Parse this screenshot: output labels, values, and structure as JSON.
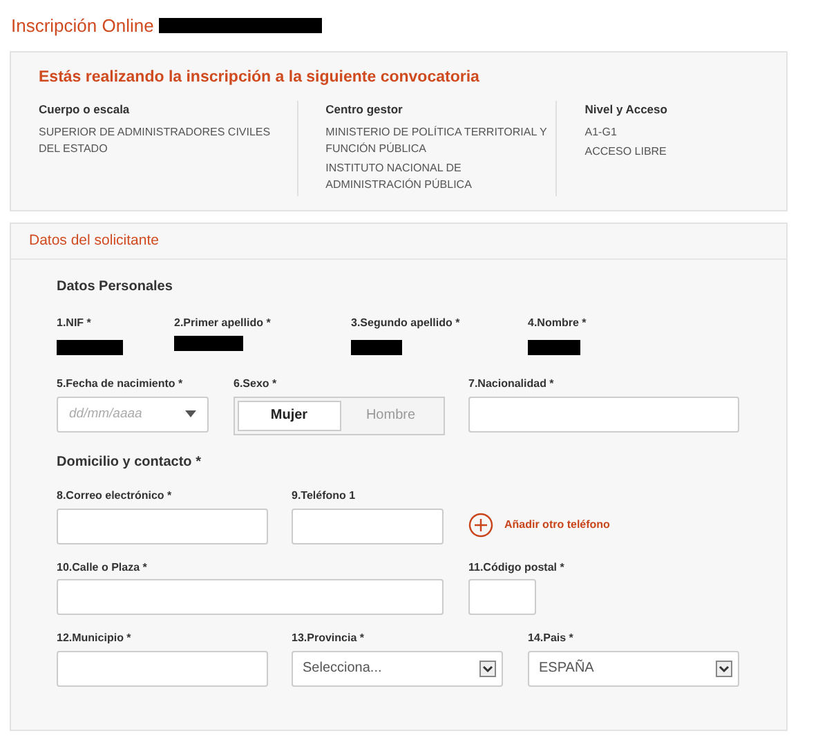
{
  "page_title": "Inscripción Online",
  "convocatoria": {
    "heading": "Estás realizando la inscripción a la siguiente convocatoria",
    "columns": [
      {
        "label": "Cuerpo o escala",
        "lines": [
          "SUPERIOR DE ADMINISTRADORES CIVILES DEL ESTADO"
        ]
      },
      {
        "label": "Centro gestor",
        "lines": [
          "MINISTERIO DE POLÍTICA TERRITORIAL Y FUNCIÓN PÚBLICA",
          "INSTITUTO NACIONAL DE ADMINISTRACIÓN PÚBLICA"
        ]
      },
      {
        "label": "Nivel y Acceso",
        "lines": [
          "A1-G1",
          "ACCESO LIBRE"
        ]
      }
    ]
  },
  "solicitante": {
    "title": "Datos del solicitante",
    "sections": [
      {
        "heading": "Datos Personales",
        "rows": [
          [
            {
              "kind": "redacted",
              "label": "1.NIF *"
            },
            {
              "kind": "redacted",
              "label": "2.Primer apellido *"
            },
            {
              "kind": "redacted",
              "label": "3.Segundo apellido *"
            },
            {
              "kind": "redacted",
              "label": "4.Nombre *"
            }
          ],
          [
            {
              "kind": "date",
              "label": "5.Fecha de nacimiento *",
              "placeholder": "dd/mm/aaaa"
            },
            {
              "kind": "toggle",
              "label": "6.Sexo *",
              "options": [
                {
                  "label": "Mujer",
                  "selected": true
                },
                {
                  "label": "Hombre",
                  "selected": false
                }
              ]
            },
            {
              "kind": "text",
              "label": "7.Nacionalidad *"
            }
          ]
        ]
      },
      {
        "heading": "Domicilio y contacto *",
        "rows": [
          [
            {
              "kind": "text",
              "label": "8.Correo electrónico *"
            },
            {
              "kind": "text",
              "label": "9.Teléfono 1"
            },
            {
              "kind": "add",
              "text": "Añadir otro teléfono"
            }
          ],
          [
            {
              "kind": "text",
              "label": "10.Calle o Plaza *"
            },
            {
              "kind": "text",
              "label": "11.Código postal *"
            }
          ],
          [
            {
              "kind": "text",
              "label": "12.Municipio *"
            },
            {
              "kind": "select",
              "label": "13.Provincia *",
              "value": "Selecciona..."
            },
            {
              "kind": "select",
              "label": "14.Pais *",
              "value": "ESPAÑA"
            }
          ]
        ]
      }
    ]
  }
}
